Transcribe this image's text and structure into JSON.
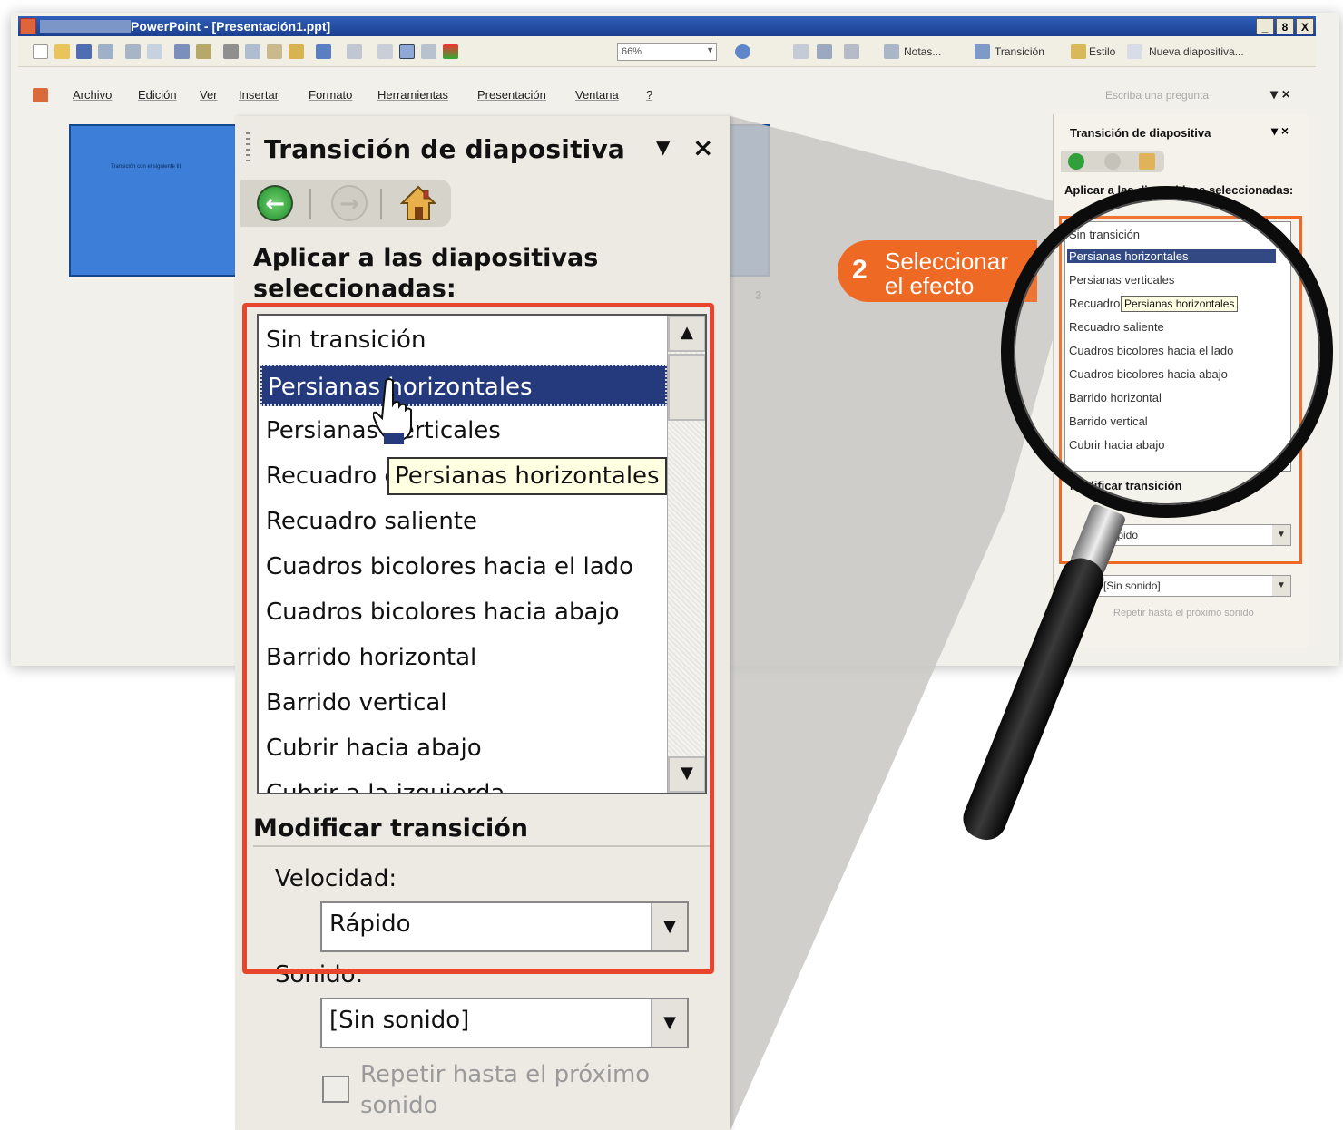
{
  "app": {
    "title": "PowerPoint - [Presentación1.ppt]",
    "window_buttons": [
      "_",
      "8",
      "X"
    ]
  },
  "toolbar": {
    "zoom": "66%",
    "notes_label": "Notas...",
    "transition_label": "Transición",
    "style_label": "Estilo",
    "new_slide_label": "Nueva diapositiva..."
  },
  "menu": {
    "items": [
      "Archivo",
      "Edición",
      "Ver",
      "Insertar",
      "Formato",
      "Herramientas",
      "Presentación",
      "Ventana",
      "?"
    ],
    "ask_placeholder": "Escriba una pregunta"
  },
  "slide": {
    "thumb_text": "Transición con el siguiente tit",
    "number": "3"
  },
  "callout": {
    "step": "2",
    "line1": "Seleccionar",
    "line2": "el efecto"
  },
  "pane": {
    "title": "Transición de diapositiva",
    "apply_label": "Aplicar a las diapositivas seleccionadas:",
    "effects": [
      "Sin transición",
      "Persianas horizontales",
      "Persianas verticales",
      "Recuadro entrante",
      "Recuadro saliente",
      "Cuadros bicolores hacia el lado",
      "Cuadros bicolores hacia abajo",
      "Barrido horizontal",
      "Barrido vertical",
      "Cubrir hacia abajo",
      "Cubrir a la izquierda"
    ],
    "selected_effect": "Persianas horizontales",
    "tooltip": "Persianas horizontales",
    "modify_label": "Modificar transición",
    "speed_label": "Velocidad:",
    "speed_value": "Rápido",
    "sound_label": "Sonido:",
    "sound_value": "[Sin sonido]",
    "repeat_label": "Repetir hasta el próximo sonido",
    "menu_glyph": "▼",
    "close_glyph": "×"
  },
  "colors": {
    "highlight_box": "#e8462c",
    "callout": "#ee6a24",
    "selection": "#243a7c",
    "title_bar": "#1c3f8f"
  }
}
